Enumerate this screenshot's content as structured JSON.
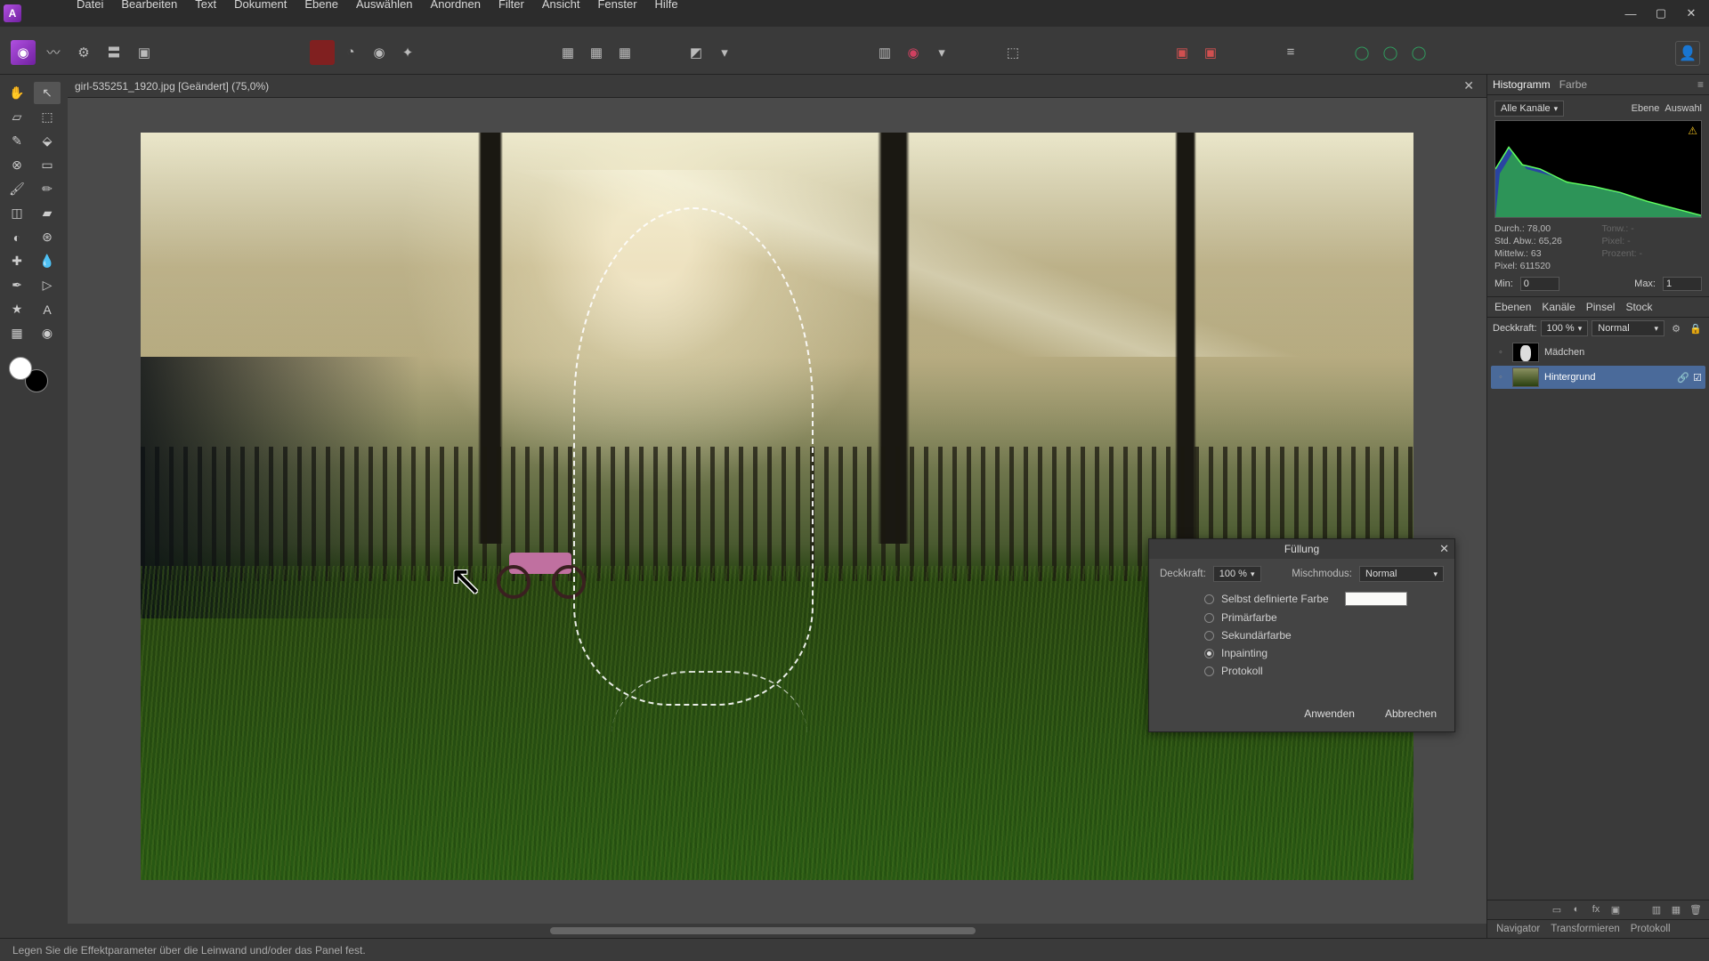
{
  "app": {
    "name": "Affinity Photo"
  },
  "menu": [
    "Datei",
    "Bearbeiten",
    "Text",
    "Dokument",
    "Ebene",
    "Auswählen",
    "Anordnen",
    "Filter",
    "Ansicht",
    "Fenster",
    "Hilfe"
  ],
  "document": {
    "tab_label": "girl-535251_1920.jpg [Geändert] (75,0%)"
  },
  "dialog": {
    "title": "Füllung",
    "opacity_label": "Deckkraft:",
    "opacity_value": "100 %",
    "blend_label": "Mischmodus:",
    "blend_value": "Normal",
    "options": {
      "custom": "Selbst definierte Farbe",
      "primary": "Primärfarbe",
      "secondary": "Sekundärfarbe",
      "inpaint": "Inpainting",
      "protocol": "Protokoll"
    },
    "selected": "inpaint",
    "apply": "Anwenden",
    "cancel": "Abbrechen"
  },
  "histogram": {
    "tab1": "Histogramm",
    "tab2": "Farbe",
    "channels_label": "Alle Kanäle",
    "btn_layer": "Ebene",
    "btn_selection": "Auswahl",
    "stats": {
      "durchlabel": "Durch.:",
      "durchval": "78,00",
      "tonwlabel": "Tonw.:",
      "tonwval": "-",
      "stdlabel": "Std. Abw.:",
      "stdval": "65,26",
      "pixellabel2": "Pixel:",
      "pixelval2": "-",
      "mittellabel": "Mittelw.:",
      "mittelval": "63",
      "prozentlabel": "Prozent:",
      "prozentval": "-",
      "pixellabel": "Pixel:",
      "pixelval": "611520"
    },
    "minlabel": "Min:",
    "minval": "0",
    "maxlabel": "Max:",
    "maxval": "1"
  },
  "layers": {
    "tab_ebenen": "Ebenen",
    "tab_kanale": "Kanäle",
    "tab_pinsel": "Pinsel",
    "tab_stock": "Stock",
    "opacity_label": "Deckkraft:",
    "opacity_value": "100 %",
    "blend_value": "Normal",
    "items": [
      {
        "name": "Mädchen",
        "selected": false
      },
      {
        "name": "Hintergrund",
        "selected": true
      }
    ]
  },
  "bottom_tabs": {
    "t1": "Navigator",
    "t2": "Transformieren",
    "t3": "Protokoll"
  },
  "statusbar": {
    "hint": "Legen Sie die Effektparameter über die Leinwand und/oder das Panel fest."
  }
}
